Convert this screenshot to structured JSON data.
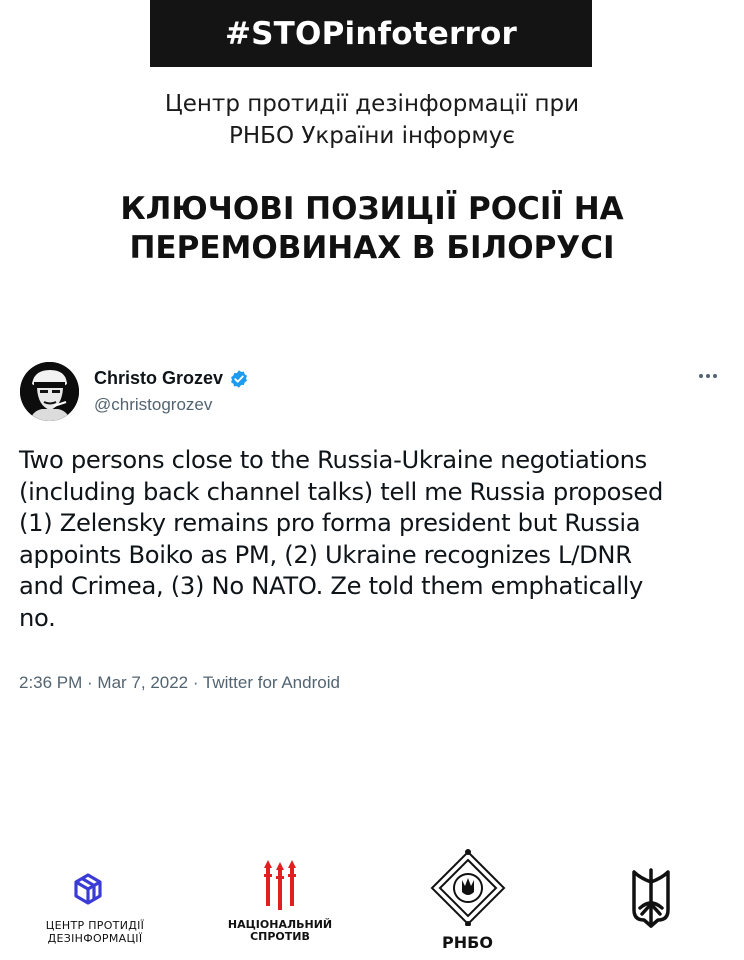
{
  "banner": {
    "hashtag": "#STOPinfoterror"
  },
  "subtitle": {
    "line1": "Центр протидії дезінформації при",
    "line2": "РНБО України інформує"
  },
  "headline": {
    "line1": "КЛЮЧОВІ ПОЗИЦІЇ РОСІЇ НА",
    "line2": "ПЕРЕМОВИНАХ В БІЛОРУСІ"
  },
  "tweet": {
    "author_name": "Christo Grozev",
    "author_handle": "@christogrozev",
    "lines": [
      "Two persons close to the Russia-Ukraine negotiations",
      "(including back channel talks) tell me Russia proposed",
      "(1) Zelensky remains pro forma president but Russia",
      "appoints Boiko as PM, (2) Ukraine recognizes L/DNR",
      "and Crimea, (3) No NATO. Ze told them emphatically",
      "no."
    ],
    "meta": "2:36 PM · Mar 7, 2022 · Twitter for Android",
    "verified_color": "#1d9bf0"
  },
  "footer": {
    "cpd": {
      "line1": "ЦЕНТР ПРОТИДІЇ",
      "line2": "ДЕЗІНФОРМАЦІЇ",
      "color": "#3b3bd6"
    },
    "nr": {
      "line1": "НАЦІОНАЛЬНИЙ",
      "line2": "СПРОТИВ",
      "color": "#e02020"
    },
    "rnbo": {
      "label": "РНБО"
    },
    "trident": {
      "icon": "trident-icon"
    }
  }
}
